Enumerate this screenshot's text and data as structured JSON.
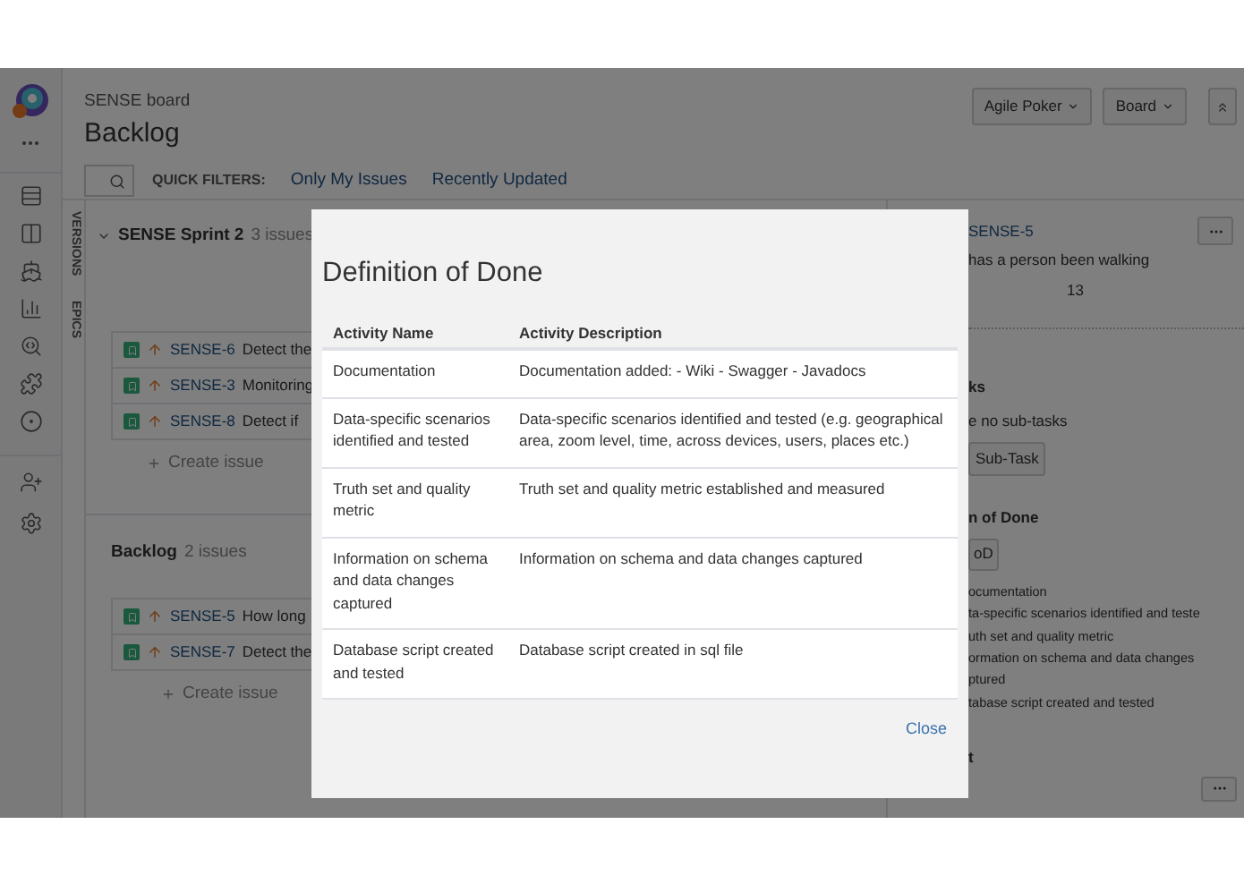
{
  "board": {
    "project": "SENSE board",
    "title": "Backlog"
  },
  "header_buttons": [
    {
      "label": "Agile Poker"
    },
    {
      "label": "Board"
    }
  ],
  "quick_filters": {
    "label": "QUICK FILTERS:",
    "items": [
      "Only My Issues",
      "Recently Updated"
    ]
  },
  "side_tabs": [
    "VERSIONS",
    "EPICS"
  ],
  "sprint": {
    "name": "SENSE Sprint 2",
    "count": "3 issues",
    "expanded": true,
    "create": "Create issue",
    "issues": [
      {
        "key": "SENSE-6",
        "summary": "Detect the"
      },
      {
        "key": "SENSE-3",
        "summary": "Monitoring"
      },
      {
        "key": "SENSE-8",
        "summary": "Detect if"
      }
    ]
  },
  "backlog": {
    "name": "Backlog",
    "count": "2 issues",
    "create": "Create issue",
    "issues": [
      {
        "key": "SENSE-5",
        "summary": "How long"
      },
      {
        "key": "SENSE-7",
        "summary": "Detect the"
      }
    ]
  },
  "detail": {
    "key": "SENSE-5",
    "summary": "has a person been walking",
    "estimate": "13",
    "subtasks_heading": "ks",
    "subtasks_empty": "e no sub-tasks",
    "subtask_button": "Sub-Task",
    "dod_heading": "n of Done",
    "dod_button": "oD",
    "dod_lines": [
      "ocumentation",
      "ta-specific scenarios identified and teste",
      "uth set and quality metric",
      "ormation on schema and data changes",
      "ptured",
      "tabase script created and tested"
    ],
    "last_heading": "t"
  },
  "dialog": {
    "title": "Definition of Done",
    "columns": [
      "Activity Name",
      "Activity Description"
    ],
    "rows": [
      {
        "name": "Documentation",
        "description": "Documentation added: - Wiki - Swagger - Javadocs"
      },
      {
        "name": "Data-specific scenarios identified and tested",
        "description": "Data-specific scenarios identified and tested (e.g. geographical area, zoom level, time, across devices, users, places etc.)"
      },
      {
        "name": "Truth set and quality metric",
        "description": "Truth set and quality metric established and measured"
      },
      {
        "name": "Information on schema and data changes captured",
        "description": "Information on schema and data changes captured"
      },
      {
        "name": "Database script created and tested",
        "description": "Database script created in sql file"
      }
    ],
    "close": "Close"
  }
}
